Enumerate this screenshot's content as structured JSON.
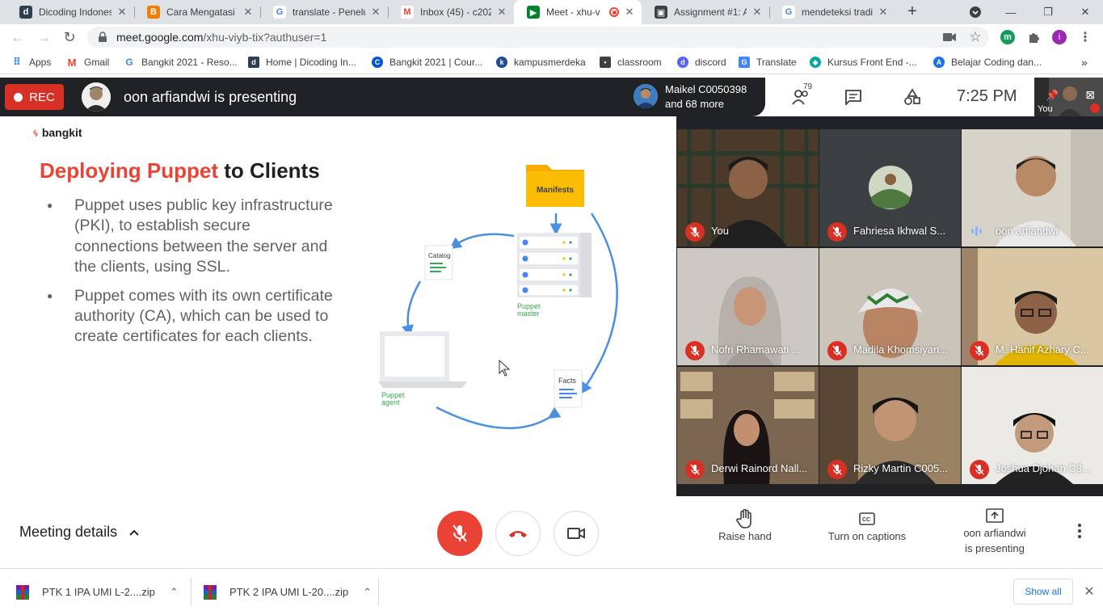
{
  "browser": {
    "tabs": [
      {
        "title": "Dicoding Indonesia",
        "favicon": "dicoding-icon",
        "color": "#2d3e50",
        "glyph": "d"
      },
      {
        "title": "Cara Mengatasi M",
        "favicon": "blogger-icon",
        "color": "#f57d00",
        "glyph": "B"
      },
      {
        "title": "translate - Penelu",
        "favicon": "google-icon",
        "color": "#4285f4",
        "glyph": "G"
      },
      {
        "title": "Inbox (45) - c2021",
        "favicon": "gmail-icon",
        "color": "#ea4335",
        "glyph": "M"
      },
      {
        "title": "Meet - xhu-v",
        "favicon": "meet-icon",
        "color": "#00832d",
        "glyph": "▶",
        "active": true
      },
      {
        "title": "Assignment #1: A",
        "favicon": "classroom-icon",
        "color": "#3c4043",
        "glyph": "▣"
      },
      {
        "title": "mendeteksi tradin",
        "favicon": "google-icon",
        "color": "#4285f4",
        "glyph": "G"
      }
    ],
    "url_host": "meet.google.com",
    "url_path": "/xhu-viyb-tix?authuser=1",
    "bookmarks": [
      {
        "label": "Apps",
        "icon": "apps-grid-icon",
        "color": "#4285f4"
      },
      {
        "label": "Gmail",
        "icon": "gmail-icon",
        "color": "#ea4335"
      },
      {
        "label": "Bangkit 2021 - Reso...",
        "icon": "google-icon",
        "color": "#4285f4"
      },
      {
        "label": "Home | Dicoding In...",
        "icon": "dicoding-icon",
        "color": "#2d3e50"
      },
      {
        "label": "Bangkit 2021 | Cour...",
        "icon": "coursera-icon",
        "color": "#0056d2"
      },
      {
        "label": "kampusmerdeka",
        "icon": "kampusmerdeka-icon",
        "color": "#1e4c9a"
      },
      {
        "label": "classroom",
        "icon": "classroom-icon",
        "color": "#3c4043"
      },
      {
        "label": "discord",
        "icon": "discord-icon",
        "color": "#5865f2"
      },
      {
        "label": "Translate",
        "icon": "translate-icon",
        "color": "#4285f4"
      },
      {
        "label": "Kursus Front End -...",
        "icon": "frontend-course-icon",
        "color": "#0aa5a5"
      },
      {
        "label": "Belajar Coding dan...",
        "icon": "coding-course-icon",
        "color": "#1a73e8"
      }
    ]
  },
  "meet": {
    "rec_label": "REC",
    "presenting_banner": "oon arfiandwi is presenting",
    "participants_summary": {
      "line1": "Maikel C0050398",
      "line2": "and 68 more"
    },
    "participant_count": "79",
    "time": "7:25 PM",
    "self_label": "You",
    "slide": {
      "logo": "bangkit",
      "title_accent": "Deploying Puppet",
      "title_rest": " to Clients",
      "bullets": [
        "Puppet uses public key infrastructure (PKI), to establish secure connections between the server and the clients, using SSL.",
        "Puppet comes with its own certificate authority (CA), which can be used to create certificates for each clients."
      ],
      "diagram": {
        "manifests": "Manifests",
        "catalog": "Catalog",
        "facts": "Facts",
        "master_label_1": "Puppet",
        "master_label_2": "master",
        "agent_label_1": "Puppet",
        "agent_label_2": "agent"
      }
    },
    "tiles": [
      {
        "name": "You",
        "muted": true,
        "bg": "#3b4a3c"
      },
      {
        "name": "Fahriesa Ikhwal S...",
        "muted": true,
        "bg": "#3c4043"
      },
      {
        "name": "oon arfiandwi",
        "muted": false,
        "bg": "#d7d2c8"
      },
      {
        "name": "Nofri Rhamawati ...",
        "muted": true,
        "bg": "#c9c4c0"
      },
      {
        "name": "Madila Khomsiyan...",
        "muted": true,
        "bg": "#c8c2ba"
      },
      {
        "name": "M. Hanif Azhary C...",
        "muted": true,
        "bg": "#c7a880"
      },
      {
        "name": "Derwi Rainord Nall...",
        "muted": true,
        "bg": "#6b5a44"
      },
      {
        "name": "Rizky Martin C005...",
        "muted": true,
        "bg": "#8a7256"
      },
      {
        "name": "Joshua Djohan C3...",
        "muted": true,
        "bg": "#e6e4e0"
      }
    ],
    "controls": {
      "meeting_details": "Meeting details",
      "raise_hand": "Raise hand",
      "captions": "Turn on captions",
      "presenting_line1": "oon arfiandwi",
      "presenting_line2": "is presenting"
    },
    "colors": {
      "accent_red": "#ea4335",
      "meet_bg": "#202124"
    }
  },
  "downloads": {
    "items": [
      {
        "name": "PTK 1 IPA  UMI L-2....zip"
      },
      {
        "name": "PTK 2 IPA UMI L-20....zip"
      }
    ],
    "show_all": "Show all"
  }
}
